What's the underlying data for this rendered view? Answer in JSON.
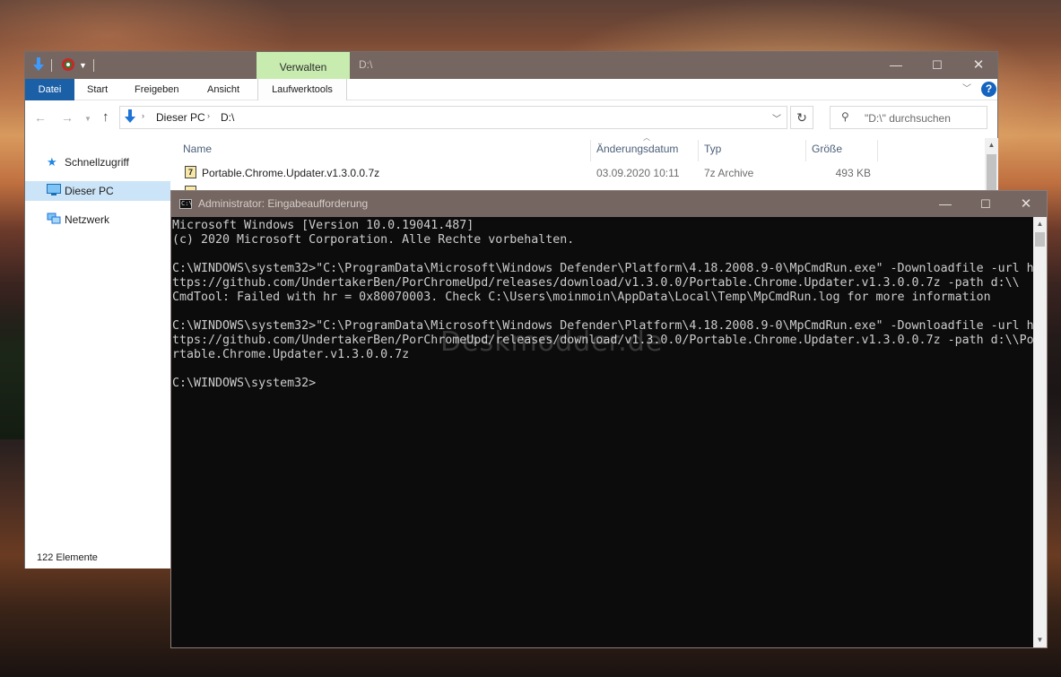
{
  "explorer": {
    "title_path": "D:\\",
    "context_tab": "Verwalten",
    "window_controls": {
      "minimize": "—",
      "maximize": "☐",
      "close": "✕"
    },
    "ribbon": {
      "tabs": [
        "Datei",
        "Start",
        "Freigeben",
        "Ansicht",
        "Laufwerktools"
      ],
      "help": "?"
    },
    "address": {
      "segments": [
        "Dieser PC",
        "D:\\"
      ],
      "search_placeholder": "\"D:\\\" durchsuchen"
    },
    "nav_pane": {
      "items": [
        {
          "label": "Schnellzugriff",
          "icon": "star-icon"
        },
        {
          "label": "Dieser PC",
          "icon": "computer-icon",
          "selected": true
        },
        {
          "label": "Netzwerk",
          "icon": "network-icon"
        }
      ]
    },
    "columns": [
      "Name",
      "Änderungsdatum",
      "Typ",
      "Größe"
    ],
    "files": [
      {
        "name": "Portable.Chrome.Updater.v1.3.0.0.7z",
        "date": "03.09.2020 10:11",
        "type": "7z Archive",
        "size": "493 KB"
      }
    ],
    "status": "122 Elemente"
  },
  "cmd": {
    "title": "Administrator: Eingabeaufforderung",
    "window_controls": {
      "minimize": "—",
      "maximize": "☐",
      "close": "✕"
    },
    "lines": [
      "Microsoft Windows [Version 10.0.19041.487]",
      "(c) 2020 Microsoft Corporation. Alle Rechte vorbehalten.",
      "",
      "C:\\WINDOWS\\system32>\"C:\\ProgramData\\Microsoft\\Windows Defender\\Platform\\4.18.2008.9-0\\MpCmdRun.exe\" -Downloadfile -url h",
      "ttps://github.com/UndertakerBen/PorChromeUpd/releases/download/v1.3.0.0/Portable.Chrome.Updater.v1.3.0.0.7z -path d:\\\\",
      "CmdTool: Failed with hr = 0x80070003. Check C:\\Users\\moinmoin\\AppData\\Local\\Temp\\MpCmdRun.log for more information",
      "",
      "C:\\WINDOWS\\system32>\"C:\\ProgramData\\Microsoft\\Windows Defender\\Platform\\4.18.2008.9-0\\MpCmdRun.exe\" -Downloadfile -url h",
      "ttps://github.com/UndertakerBen/PorChromeUpd/releases/download/v1.3.0.0/Portable.Chrome.Updater.v1.3.0.0.7z -path d:\\\\Po",
      "rtable.Chrome.Updater.v1.3.0.0.7z",
      "",
      "C:\\WINDOWS\\system32>"
    ],
    "watermark": "Deskmodder.de"
  }
}
